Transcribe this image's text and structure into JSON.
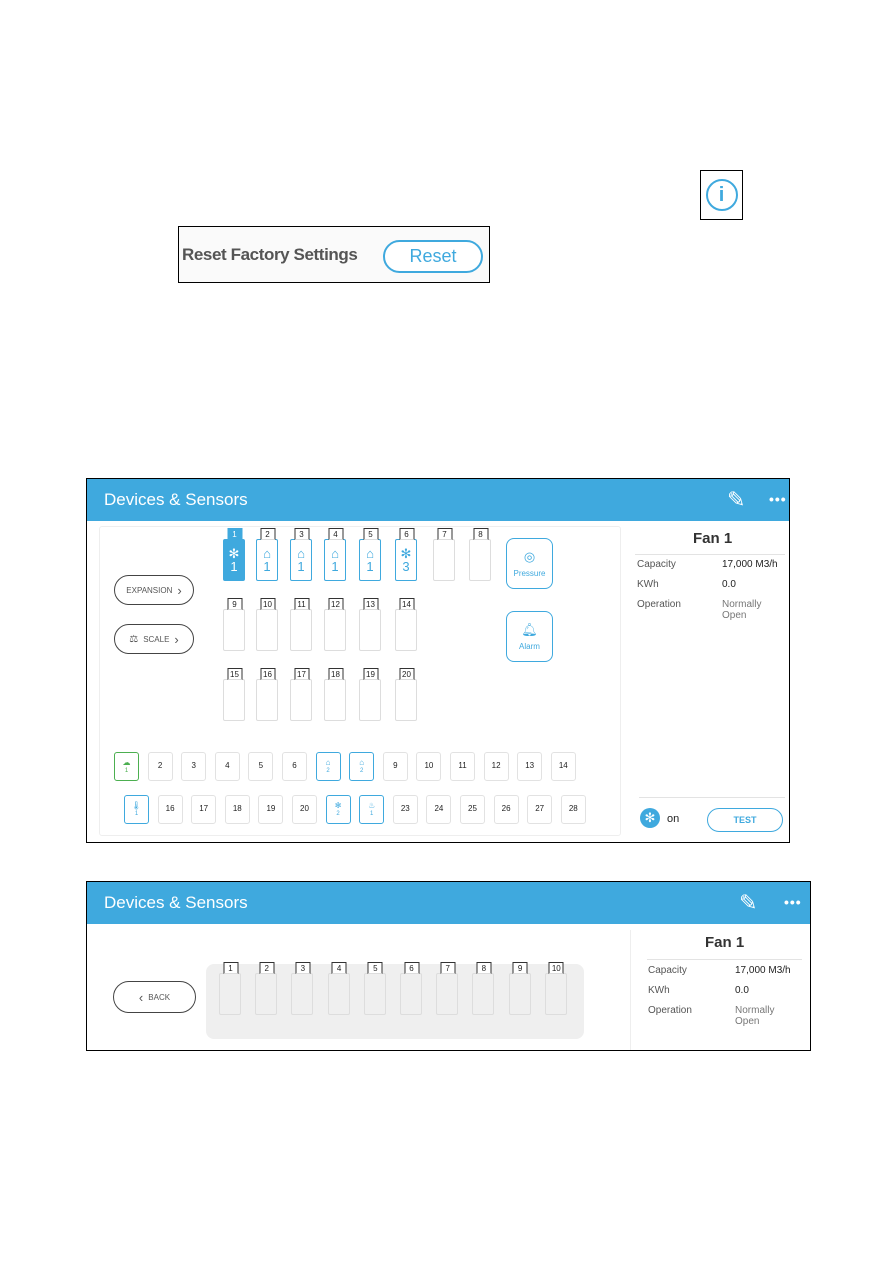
{
  "top": {
    "info_icon": "info-icon",
    "reset_label": "Reset Factory Settings",
    "reset_button": "Reset"
  },
  "screen1": {
    "title": "Devices & Sensors",
    "edit_icon": "pencil-icon",
    "more_icon": "more-dots-icon",
    "expansion_button": "EXPANSION",
    "scale_button": "SCALE",
    "modules": [
      {
        "num": "1",
        "icon": "fan",
        "count": "1",
        "state": "selected"
      },
      {
        "num": "2",
        "icon": "inlet",
        "count": "1",
        "state": "active"
      },
      {
        "num": "3",
        "icon": "inlet",
        "count": "1",
        "state": "active"
      },
      {
        "num": "4",
        "icon": "curtain",
        "count": "1",
        "state": "active"
      },
      {
        "num": "5",
        "icon": "curtain",
        "count": "1",
        "state": "active"
      },
      {
        "num": "6",
        "icon": "fan",
        "count": "3",
        "state": "active"
      },
      {
        "num": "7"
      },
      {
        "num": "8"
      },
      {
        "num": "9"
      },
      {
        "num": "10"
      },
      {
        "num": "11"
      },
      {
        "num": "12"
      },
      {
        "num": "13"
      },
      {
        "num": "14"
      },
      {
        "num": "15"
      },
      {
        "num": "16"
      },
      {
        "num": "17"
      },
      {
        "num": "18"
      },
      {
        "num": "19"
      },
      {
        "num": "20"
      }
    ],
    "pressure_label": "Pressure",
    "alarm_label": "Alarm",
    "inputs_row1": [
      {
        "icon": "weather",
        "count": "1",
        "color": "green"
      },
      {
        "num": "2"
      },
      {
        "num": "3"
      },
      {
        "num": "4"
      },
      {
        "num": "5"
      },
      {
        "num": "6"
      },
      {
        "icon": "inlet",
        "count": "2",
        "color": "blue"
      },
      {
        "icon": "curtain",
        "count": "2",
        "color": "blue"
      },
      {
        "num": "9"
      },
      {
        "num": "10"
      },
      {
        "num": "11"
      },
      {
        "num": "12"
      },
      {
        "num": "13"
      },
      {
        "num": "14"
      }
    ],
    "inputs_row2": [
      {
        "icon": "thermometer",
        "count": "1",
        "color": "blue"
      },
      {
        "num": "16"
      },
      {
        "num": "17"
      },
      {
        "num": "18"
      },
      {
        "num": "19"
      },
      {
        "num": "20"
      },
      {
        "icon": "fan",
        "count": "2",
        "color": "blue"
      },
      {
        "icon": "heater",
        "count": "1",
        "color": "blue"
      },
      {
        "num": "23"
      },
      {
        "num": "24"
      },
      {
        "num": "25"
      },
      {
        "num": "26"
      },
      {
        "num": "27"
      },
      {
        "num": "28"
      }
    ],
    "detail": {
      "title": "Fan 1",
      "rows": [
        [
          "Capacity",
          "17,000 M3/h"
        ],
        [
          "KWh",
          "0.0"
        ],
        [
          "Operation",
          "Normally\nOpen"
        ]
      ],
      "status": "on",
      "test_button": "TEST"
    }
  },
  "screen2": {
    "title": "Devices & Sensors",
    "back_button": "BACK",
    "modules": [
      "1",
      "2",
      "3",
      "4",
      "5",
      "6",
      "7",
      "8",
      "9",
      "10"
    ],
    "detail": {
      "title": "Fan 1",
      "rows": [
        [
          "Capacity",
          "17,000 M3/h"
        ],
        [
          "KWh",
          "0.0"
        ],
        [
          "Operation",
          "Normally\nOpen"
        ]
      ]
    }
  },
  "colors": {
    "accent": "#3fa9de",
    "green": "#4caf50"
  }
}
